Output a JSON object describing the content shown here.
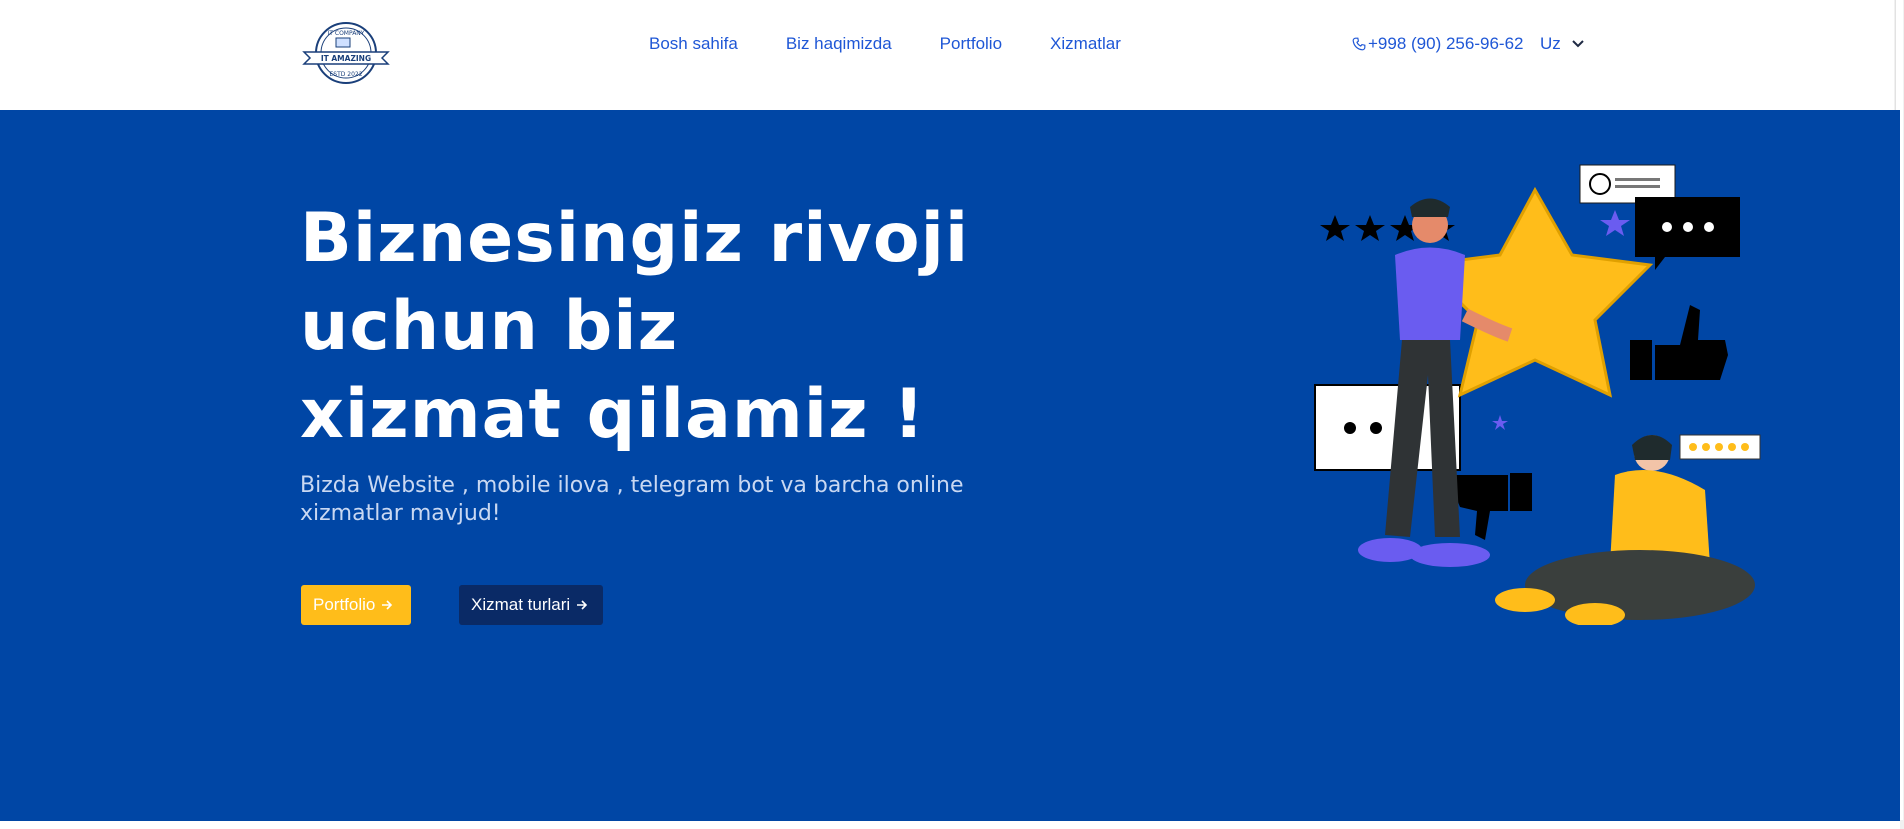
{
  "header": {
    "logo": {
      "top_text": "IT COMPANY",
      "ribbon_text": "IT AMAZING",
      "bottom_text": "ESTD 2022"
    },
    "nav": [
      {
        "label": "Bosh sahifa"
      },
      {
        "label": "Biz haqimizda"
      },
      {
        "label": "Portfolio"
      },
      {
        "label": "Xizmatlar"
      }
    ],
    "phone": "+998 (90) 256-96-62",
    "language": "Uz"
  },
  "hero": {
    "title_line1": "Biznesingiz rivoji",
    "title_line2": "uchun biz",
    "title_line3": "xizmat qilamiz !",
    "subtitle": "Bizda Website , mobile ilova , telegram bot va barcha online xizmatlar mavjud!",
    "buttons": {
      "portfolio": "Portfolio",
      "services": "Xizmat turlari"
    }
  },
  "colors": {
    "hero_bg": "#0046a5",
    "nav_link": "#1f57d6",
    "accent_yellow": "#ffbd1a",
    "dark_button": "#0a2a66"
  },
  "icons": {
    "phone": "phone-icon",
    "language_dropdown": "chevron-down-icon",
    "button_arrow": "arrow-right-icon"
  }
}
